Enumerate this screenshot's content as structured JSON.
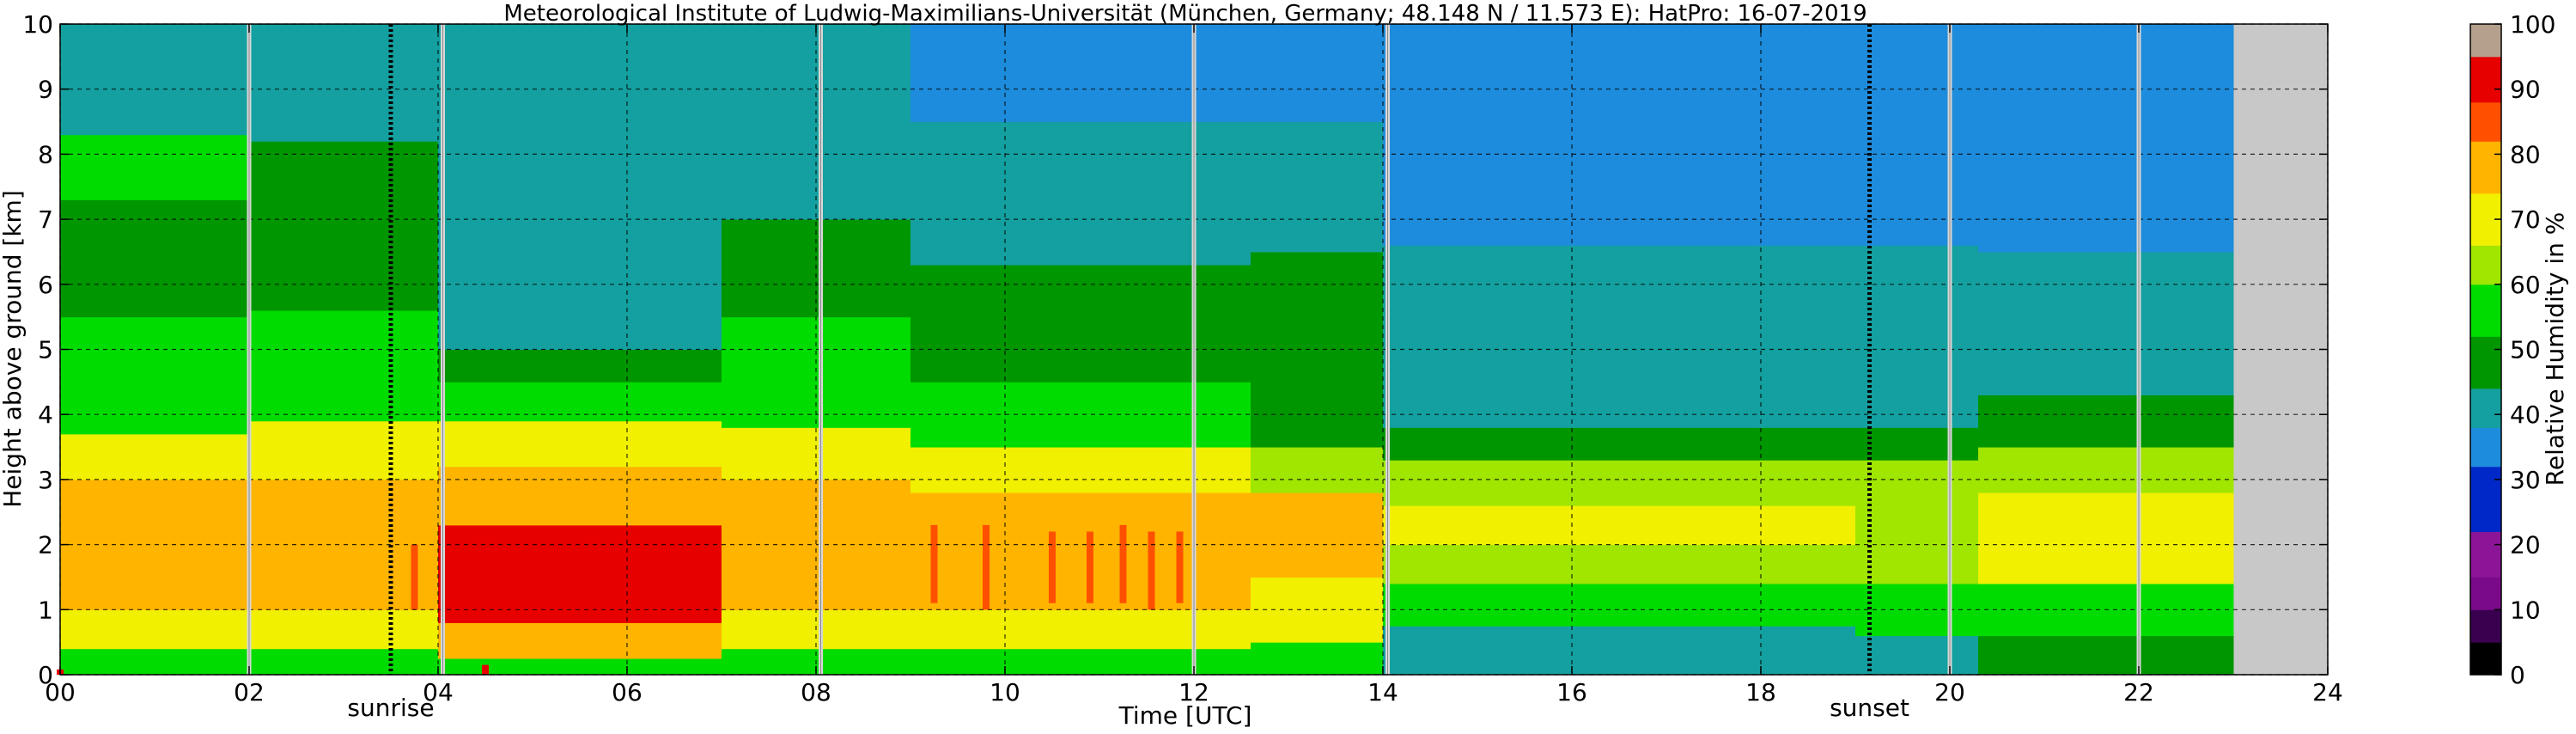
{
  "chart_data": {
    "type": "heatmap",
    "title": "Meteorological Institute of Ludwig-Maximilians-Universität (München, Germany; 48.148 N / 11.573 E):    HatPro: 16-07-2019",
    "xlabel": "Time [UTC]",
    "ylabel": "Height above ground [km]",
    "colorbar_label": "Relative Humidity in %",
    "xlim": [
      0,
      24
    ],
    "ylim": [
      0,
      10
    ],
    "clim": [
      0,
      100
    ],
    "x_ticks": [
      "00",
      "02",
      "04",
      "06",
      "08",
      "10",
      "12",
      "14",
      "16",
      "18",
      "20",
      "22",
      "24"
    ],
    "y_ticks": [
      "0",
      "1",
      "2",
      "3",
      "4",
      "5",
      "6",
      "7",
      "8",
      "9",
      "10"
    ],
    "colorbar_ticks": [
      "0",
      "10",
      "20",
      "30",
      "40",
      "50",
      "60",
      "70",
      "80",
      "90",
      "100"
    ],
    "grid": true,
    "grid_style": "dashed",
    "data_end_hour": 23,
    "missing_color": "#c8c8c8",
    "annotations": [
      {
        "text": "sunrise",
        "x": 3.5
      },
      {
        "text": "sunset",
        "x": 19.15
      }
    ],
    "sun_lines": [
      3.5,
      19.15
    ],
    "scan_markers": [
      2.0,
      4.05,
      8.05,
      12.0,
      14.05,
      20.0,
      22.0
    ],
    "colorscale": [
      {
        "from": 0,
        "to": 5,
        "color": "#000000"
      },
      {
        "from": 5,
        "to": 10,
        "color": "#3a0050"
      },
      {
        "from": 10,
        "to": 15,
        "color": "#7a0a8a"
      },
      {
        "from": 15,
        "to": 22,
        "color": "#8c1496"
      },
      {
        "from": 22,
        "to": 32,
        "color": "#0028c8"
      },
      {
        "from": 32,
        "to": 38,
        "color": "#1e8cdc"
      },
      {
        "from": 38,
        "to": 44,
        "color": "#14a0a0"
      },
      {
        "from": 44,
        "to": 52,
        "color": "#009600"
      },
      {
        "from": 52,
        "to": 60,
        "color": "#00dc00"
      },
      {
        "from": 60,
        "to": 66,
        "color": "#a0e600"
      },
      {
        "from": 66,
        "to": 74,
        "color": "#f0f000"
      },
      {
        "from": 74,
        "to": 82,
        "color": "#ffb400"
      },
      {
        "from": 82,
        "to": 88,
        "color": "#ff5000"
      },
      {
        "from": 88,
        "to": 95,
        "color": "#e60000"
      },
      {
        "from": 95,
        "to": 100,
        "color": "#b4a08c"
      }
    ],
    "bands": [
      {
        "hour_start": 0,
        "hour_end": 2,
        "layers": [
          [
            0,
            0.4,
            55
          ],
          [
            0.4,
            1.0,
            66
          ],
          [
            1.0,
            3.0,
            78
          ],
          [
            3.0,
            3.7,
            68
          ],
          [
            3.7,
            5.5,
            55
          ],
          [
            5.5,
            7.3,
            50
          ],
          [
            7.3,
            8.3,
            52
          ],
          [
            8.3,
            10,
            42
          ]
        ]
      },
      {
        "hour_start": 2,
        "hour_end": 4,
        "layers": [
          [
            0,
            0.4,
            55
          ],
          [
            0.4,
            1.0,
            66
          ],
          [
            1.0,
            3.0,
            78
          ],
          [
            3.0,
            3.9,
            68
          ],
          [
            3.9,
            5.6,
            55
          ],
          [
            5.6,
            7.6,
            50
          ],
          [
            7.6,
            8.2,
            44
          ],
          [
            8.2,
            10,
            40
          ]
        ]
      },
      {
        "hour_start": 4,
        "hour_end": 7,
        "layers": [
          [
            0,
            0.25,
            55
          ],
          [
            0.25,
            0.8,
            80
          ],
          [
            0.8,
            2.3,
            88
          ],
          [
            2.3,
            3.2,
            78
          ],
          [
            3.2,
            3.9,
            68
          ],
          [
            3.9,
            4.5,
            55
          ],
          [
            4.5,
            5.0,
            48
          ],
          [
            5.0,
            10,
            40
          ]
        ]
      },
      {
        "hour_start": 7,
        "hour_end": 9,
        "layers": [
          [
            0,
            0.4,
            55
          ],
          [
            0.4,
            1.0,
            66
          ],
          [
            1.0,
            3.0,
            78
          ],
          [
            3.0,
            3.8,
            68
          ],
          [
            3.8,
            5.5,
            55
          ],
          [
            5.5,
            7.0,
            48
          ],
          [
            7.0,
            10,
            40
          ]
        ]
      },
      {
        "hour_start": 9,
        "hour_end": 12.6,
        "layers": [
          [
            0,
            0.4,
            55
          ],
          [
            0.4,
            1.0,
            66
          ],
          [
            1.0,
            2.8,
            78
          ],
          [
            2.8,
            3.5,
            66
          ],
          [
            3.5,
            4.5,
            55
          ],
          [
            4.5,
            6.3,
            46
          ],
          [
            6.3,
            8.5,
            40
          ],
          [
            8.5,
            10,
            34
          ]
        ]
      },
      {
        "hour_start": 12.6,
        "hour_end": 14,
        "layers": [
          [
            0,
            0.5,
            52
          ],
          [
            0.5,
            1.5,
            66
          ],
          [
            1.5,
            2.8,
            76
          ],
          [
            2.8,
            3.5,
            62
          ],
          [
            3.5,
            4.8,
            50
          ],
          [
            4.8,
            6.5,
            44
          ],
          [
            6.5,
            8.5,
            40
          ],
          [
            8.5,
            10,
            34
          ]
        ]
      },
      {
        "hour_start": 14,
        "hour_end": 19,
        "layers": [
          [
            0,
            0.75,
            42
          ],
          [
            0.75,
            1.4,
            55
          ],
          [
            1.4,
            2.0,
            62
          ],
          [
            2.0,
            2.6,
            66
          ],
          [
            2.6,
            3.3,
            60
          ],
          [
            3.3,
            3.8,
            50
          ],
          [
            3.8,
            6.6,
            40
          ],
          [
            6.6,
            10,
            34
          ]
        ]
      },
      {
        "hour_start": 19,
        "hour_end": 20.3,
        "layers": [
          [
            0,
            0.6,
            42
          ],
          [
            0.6,
            1.4,
            55
          ],
          [
            1.4,
            2.6,
            64
          ],
          [
            2.6,
            3.3,
            60
          ],
          [
            3.3,
            3.8,
            50
          ],
          [
            3.8,
            6.6,
            40
          ],
          [
            6.6,
            10,
            34
          ]
        ]
      },
      {
        "hour_start": 20.3,
        "hour_end": 23,
        "layers": [
          [
            0,
            0.6,
            50
          ],
          [
            0.6,
            1.4,
            58
          ],
          [
            1.4,
            2.8,
            66
          ],
          [
            2.8,
            3.5,
            60
          ],
          [
            3.5,
            4.3,
            50
          ],
          [
            4.3,
            6.5,
            40
          ],
          [
            6.5,
            10,
            34
          ]
        ]
      }
    ],
    "streaks": [
      {
        "hour": 9.25,
        "from": 1.1,
        "to": 2.3,
        "value": 86
      },
      {
        "hour": 9.8,
        "from": 1.0,
        "to": 2.3,
        "value": 87
      },
      {
        "hour": 10.5,
        "from": 1.1,
        "to": 2.2,
        "value": 86
      },
      {
        "hour": 10.9,
        "from": 1.1,
        "to": 2.2,
        "value": 85
      },
      {
        "hour": 11.25,
        "from": 1.1,
        "to": 2.3,
        "value": 86
      },
      {
        "hour": 11.55,
        "from": 1.0,
        "to": 2.2,
        "value": 85
      },
      {
        "hour": 11.85,
        "from": 1.1,
        "to": 2.2,
        "value": 86
      },
      {
        "hour": 3.75,
        "from": 1.0,
        "to": 2.0,
        "value": 86
      },
      {
        "hour": 0.0,
        "from": 0.0,
        "to": 0.08,
        "value": 90
      },
      {
        "hour": 4.5,
        "from": 0.0,
        "to": 0.15,
        "value": 90
      }
    ]
  }
}
